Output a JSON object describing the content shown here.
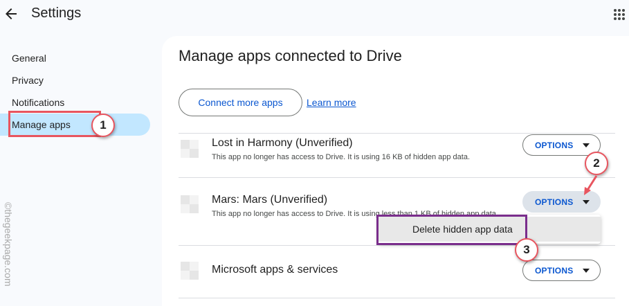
{
  "header": {
    "title": "Settings",
    "back_icon": "arrow-left-icon",
    "apps_icon": "grid-icon"
  },
  "sidebar": {
    "items": [
      {
        "label": "General"
      },
      {
        "label": "Privacy"
      },
      {
        "label": "Notifications"
      },
      {
        "label": "Manage apps",
        "active": true
      }
    ]
  },
  "main": {
    "heading": "Manage apps connected to Drive",
    "connect_label": "Connect more apps",
    "learn_more": "Learn more",
    "apps": [
      {
        "name": "Lost in Harmony (Unverified)",
        "description": "This app no longer has access to Drive. It is using 16 KB of hidden app data.",
        "options_label": "OPTIONS"
      },
      {
        "name": "Mars: Mars (Unverified)",
        "description": "This app no longer has access to Drive. It is using less than 1 KB of hidden app data.",
        "options_label": "OPTIONS"
      },
      {
        "name": "Microsoft apps & services",
        "description": "",
        "options_label": "OPTIONS"
      }
    ],
    "menu": {
      "items": [
        {
          "label": "Delete hidden app data"
        }
      ]
    }
  },
  "annotations": {
    "steps": [
      "1",
      "2",
      "3"
    ],
    "watermark": "©thegeekpage.com"
  },
  "colors": {
    "accent": "#0b57d0",
    "active_nav": "#c2e7ff",
    "highlight_red": "#e8555f",
    "highlight_purple": "#7a2d8c"
  }
}
